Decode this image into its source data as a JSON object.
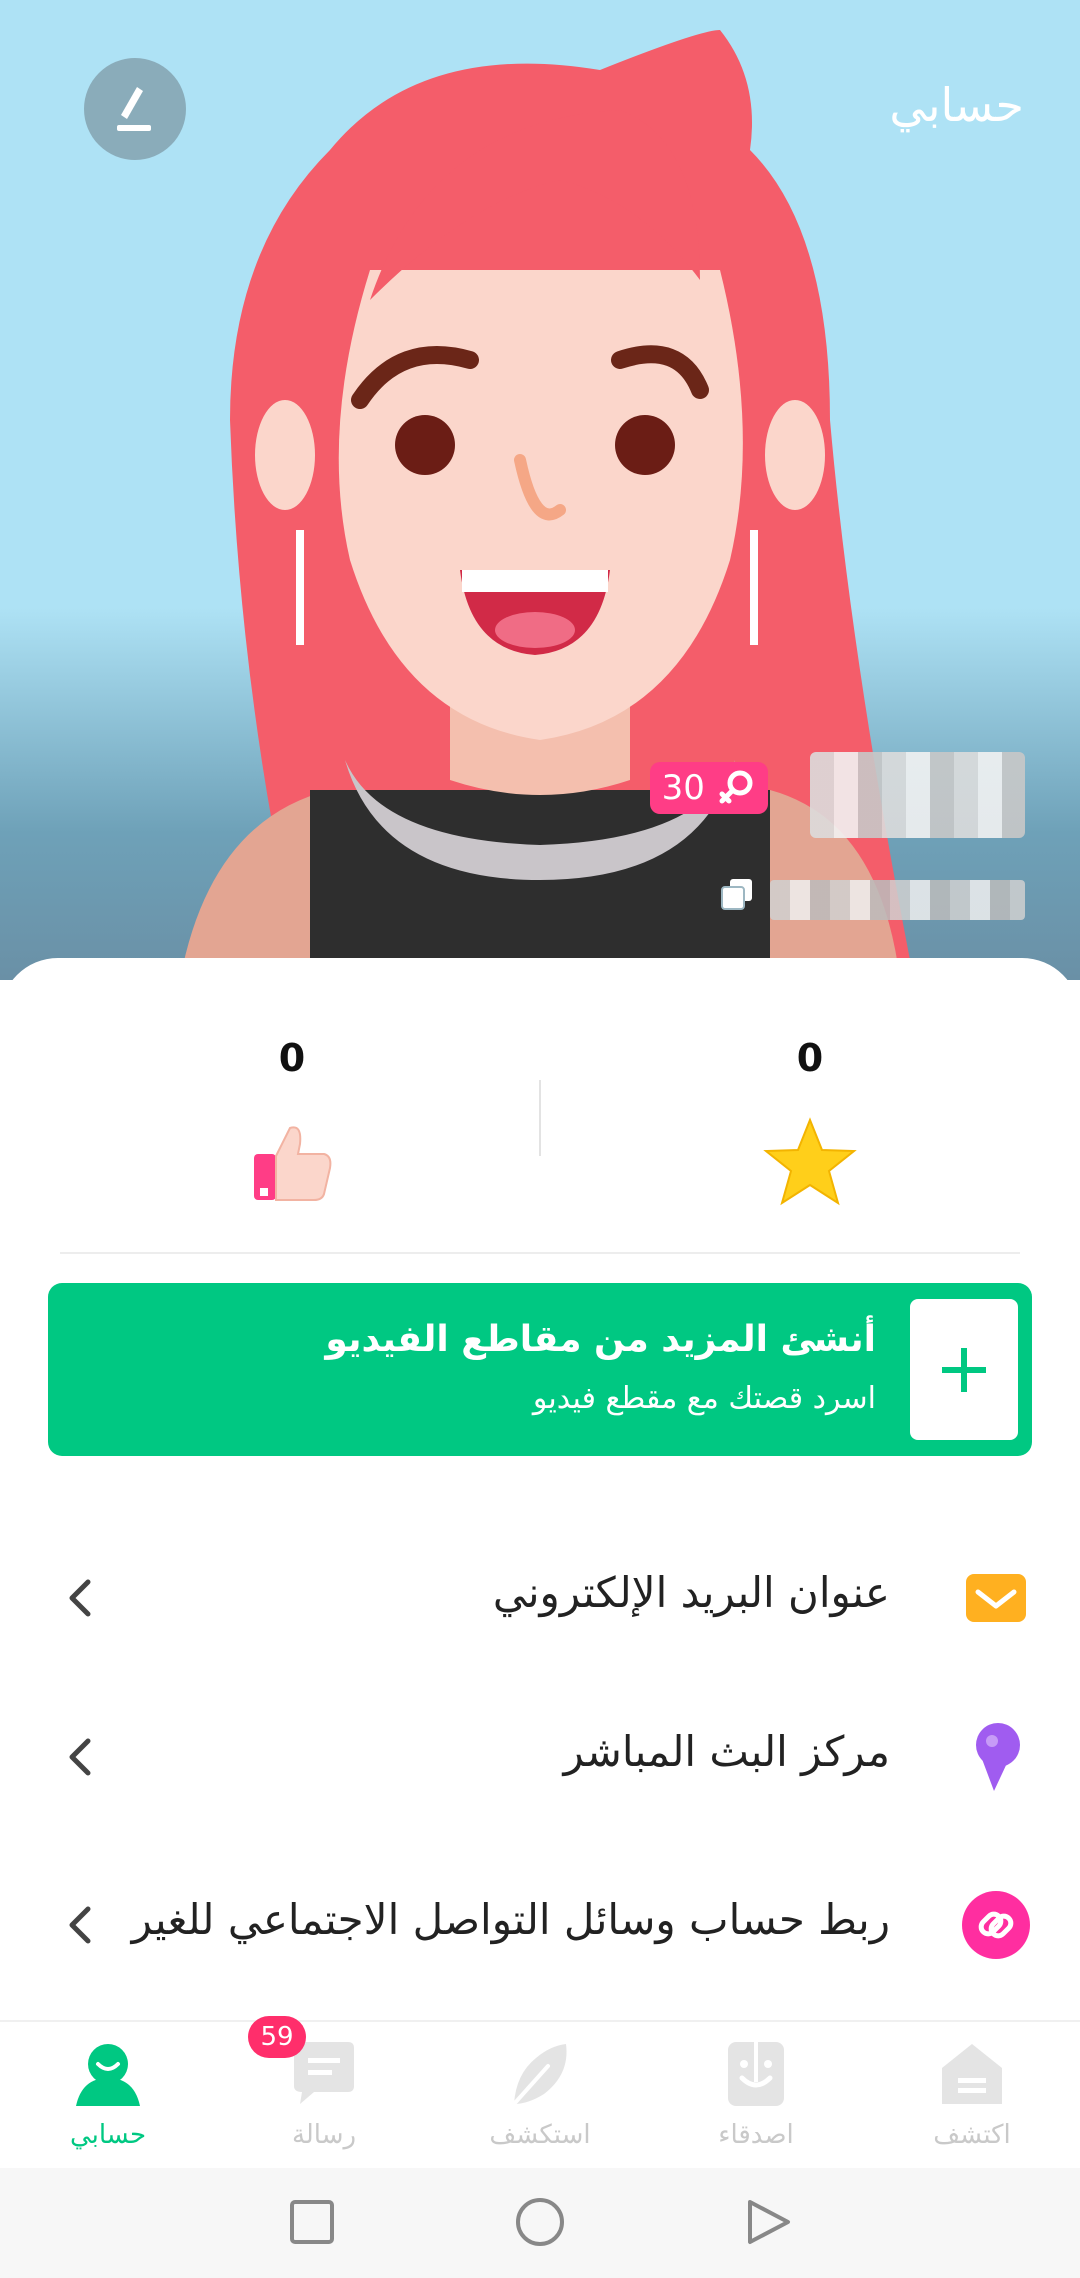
{
  "header": {
    "title": "حسابي"
  },
  "profile": {
    "level": "30"
  },
  "stats": [
    {
      "count": "0",
      "icon": "star-icon"
    },
    {
      "count": "0",
      "icon": "thumbs-up-icon"
    }
  ],
  "create": {
    "title": "أنشئ المزيد من مقاطع الفيديو",
    "subtitle": "اسرد قصتك مع مقطع فيديو"
  },
  "menu": [
    {
      "label": "عنوان البريد الإلكتروني",
      "icon": "mail-icon",
      "color": "#ffb020"
    },
    {
      "label": "مركز البث المباشر",
      "icon": "microphone-icon",
      "color": "#a05cf0"
    },
    {
      "label": "ربط حساب وسائل التواصل الاجتماعي للغير",
      "icon": "link-icon",
      "color": "#ff2ea0"
    }
  ],
  "nav": {
    "items": [
      {
        "label": "اكتشف"
      },
      {
        "label": "اصدقاء"
      },
      {
        "label": "استكشف"
      },
      {
        "label": "رسالة"
      },
      {
        "label": "حسابي"
      }
    ],
    "message_badge": "59",
    "accent": "#00c882"
  }
}
